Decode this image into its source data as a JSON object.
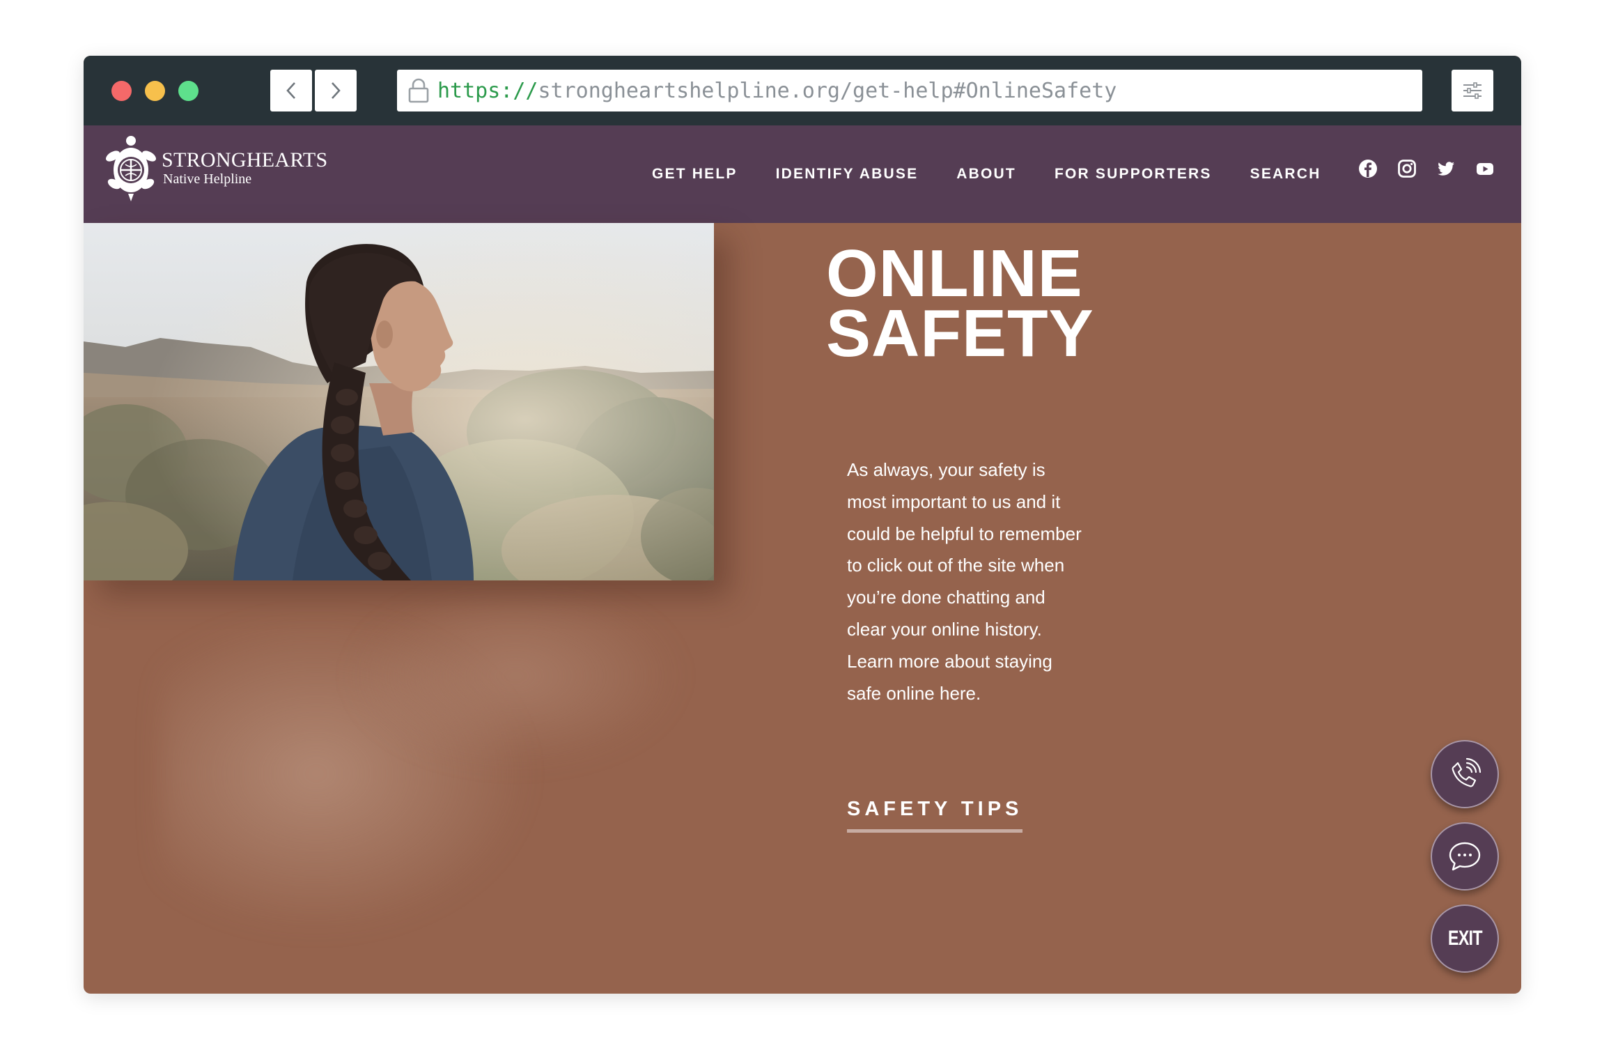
{
  "browser": {
    "url_scheme": "https://",
    "url_rest": "strongheartshelpline.org/get-help#OnlineSafety",
    "traffic_lights": [
      "#f56969",
      "#f7c04c",
      "#5ee08c"
    ]
  },
  "site": {
    "logo": {
      "name": "STRONGHEARTS",
      "subtitle": "Native Helpline"
    },
    "nav": [
      {
        "label": "GET HELP"
      },
      {
        "label": "IDENTIFY ABUSE"
      },
      {
        "label": "ABOUT"
      },
      {
        "label": "FOR SUPPORTERS"
      },
      {
        "label": "SEARCH"
      }
    ],
    "social": [
      "facebook-icon",
      "instagram-icon",
      "twitter-icon",
      "youtube-icon"
    ],
    "colors": {
      "header": "#553d54",
      "content": "#95634d",
      "browser_chrome": "#283338"
    }
  },
  "content": {
    "title_line1": "ONLINE",
    "title_line2": "SAFETY",
    "body": "As always, your safety is most important to us and it could be helpful to remember to click out of the site when you’re done chatting and clear your online history. Learn more about staying safe online here.",
    "link": "SAFETY TIPS"
  },
  "floating_actions": {
    "call_icon": "phone-call-icon",
    "chat_icon": "chat-bubble-icon",
    "exit_label": "EXIT"
  }
}
